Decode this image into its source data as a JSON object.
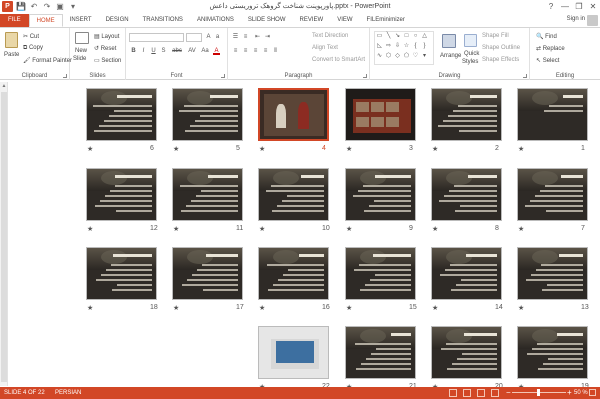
{
  "window": {
    "title": "پاورپوینت شناخت گروهک تروریستی داعش.pptx - PowerPoint",
    "controls": [
      "?",
      "—",
      "❐",
      "✕"
    ]
  },
  "qat": {
    "save": "💾",
    "undo": "↶",
    "redo": "↷",
    "start": "▣",
    "more": "▾"
  },
  "tabs": [
    "FILE",
    "HOME",
    "INSERT",
    "DESIGN",
    "TRANSITIONS",
    "ANIMATIONS",
    "SLIDE SHOW",
    "REVIEW",
    "VIEW",
    "FILEminimizer"
  ],
  "account": {
    "signin": "Sign in"
  },
  "ribbon": {
    "clipboard": {
      "paste": "Paste",
      "cut": "Cut",
      "copy": "Copy",
      "format_painter": "Format Painter",
      "label": "Clipboard"
    },
    "slides": {
      "new_slide": "New",
      "new_slide2": "Slide",
      "layout": "Layout",
      "reset": "Reset",
      "section": "Section",
      "label": "Slides"
    },
    "font": {
      "label": "Font",
      "buttons": [
        "B",
        "I",
        "U",
        "S",
        "abc",
        "AV",
        "Aa",
        "A"
      ]
    },
    "paragraph": {
      "text_direction": "Text Direction",
      "align_text": "Align Text",
      "convert": "Convert to SmartArt",
      "label": "Paragraph"
    },
    "drawing": {
      "arrange": "Arrange",
      "quick_styles": "Quick",
      "quick_styles2": "Styles",
      "shape_fill": "Shape Fill",
      "shape_outline": "Shape Outline",
      "shape_effects": "Shape Effects",
      "label": "Drawing"
    },
    "editing": {
      "find": "Find",
      "replace": "Replace",
      "select": "Select",
      "label": "Editing"
    }
  },
  "slides": [
    {
      "num": "1",
      "kind": "title"
    },
    {
      "num": "2",
      "kind": "text"
    },
    {
      "num": "3",
      "kind": "photos"
    },
    {
      "num": "4",
      "kind": "photo",
      "selected": true
    },
    {
      "num": "5",
      "kind": "text"
    },
    {
      "num": "6",
      "kind": "text"
    },
    {
      "num": "7",
      "kind": "text"
    },
    {
      "num": "8",
      "kind": "text"
    },
    {
      "num": "9",
      "kind": "text"
    },
    {
      "num": "10",
      "kind": "text"
    },
    {
      "num": "11",
      "kind": "text"
    },
    {
      "num": "12",
      "kind": "text"
    },
    {
      "num": "13",
      "kind": "text"
    },
    {
      "num": "14",
      "kind": "text"
    },
    {
      "num": "15",
      "kind": "text"
    },
    {
      "num": "16",
      "kind": "text"
    },
    {
      "num": "17",
      "kind": "text"
    },
    {
      "num": "18",
      "kind": "text"
    },
    {
      "num": "19",
      "kind": "text"
    },
    {
      "num": "20",
      "kind": "text"
    },
    {
      "num": "21",
      "kind": "text"
    },
    {
      "num": "22",
      "kind": "laptop"
    }
  ],
  "star": "★",
  "status": {
    "slide": "SLIDE 4 OF 22",
    "language": "PERSIAN",
    "zoom": "50 %",
    "minus": "−",
    "plus": "+"
  },
  "colors": {
    "accent": "#d24726"
  }
}
